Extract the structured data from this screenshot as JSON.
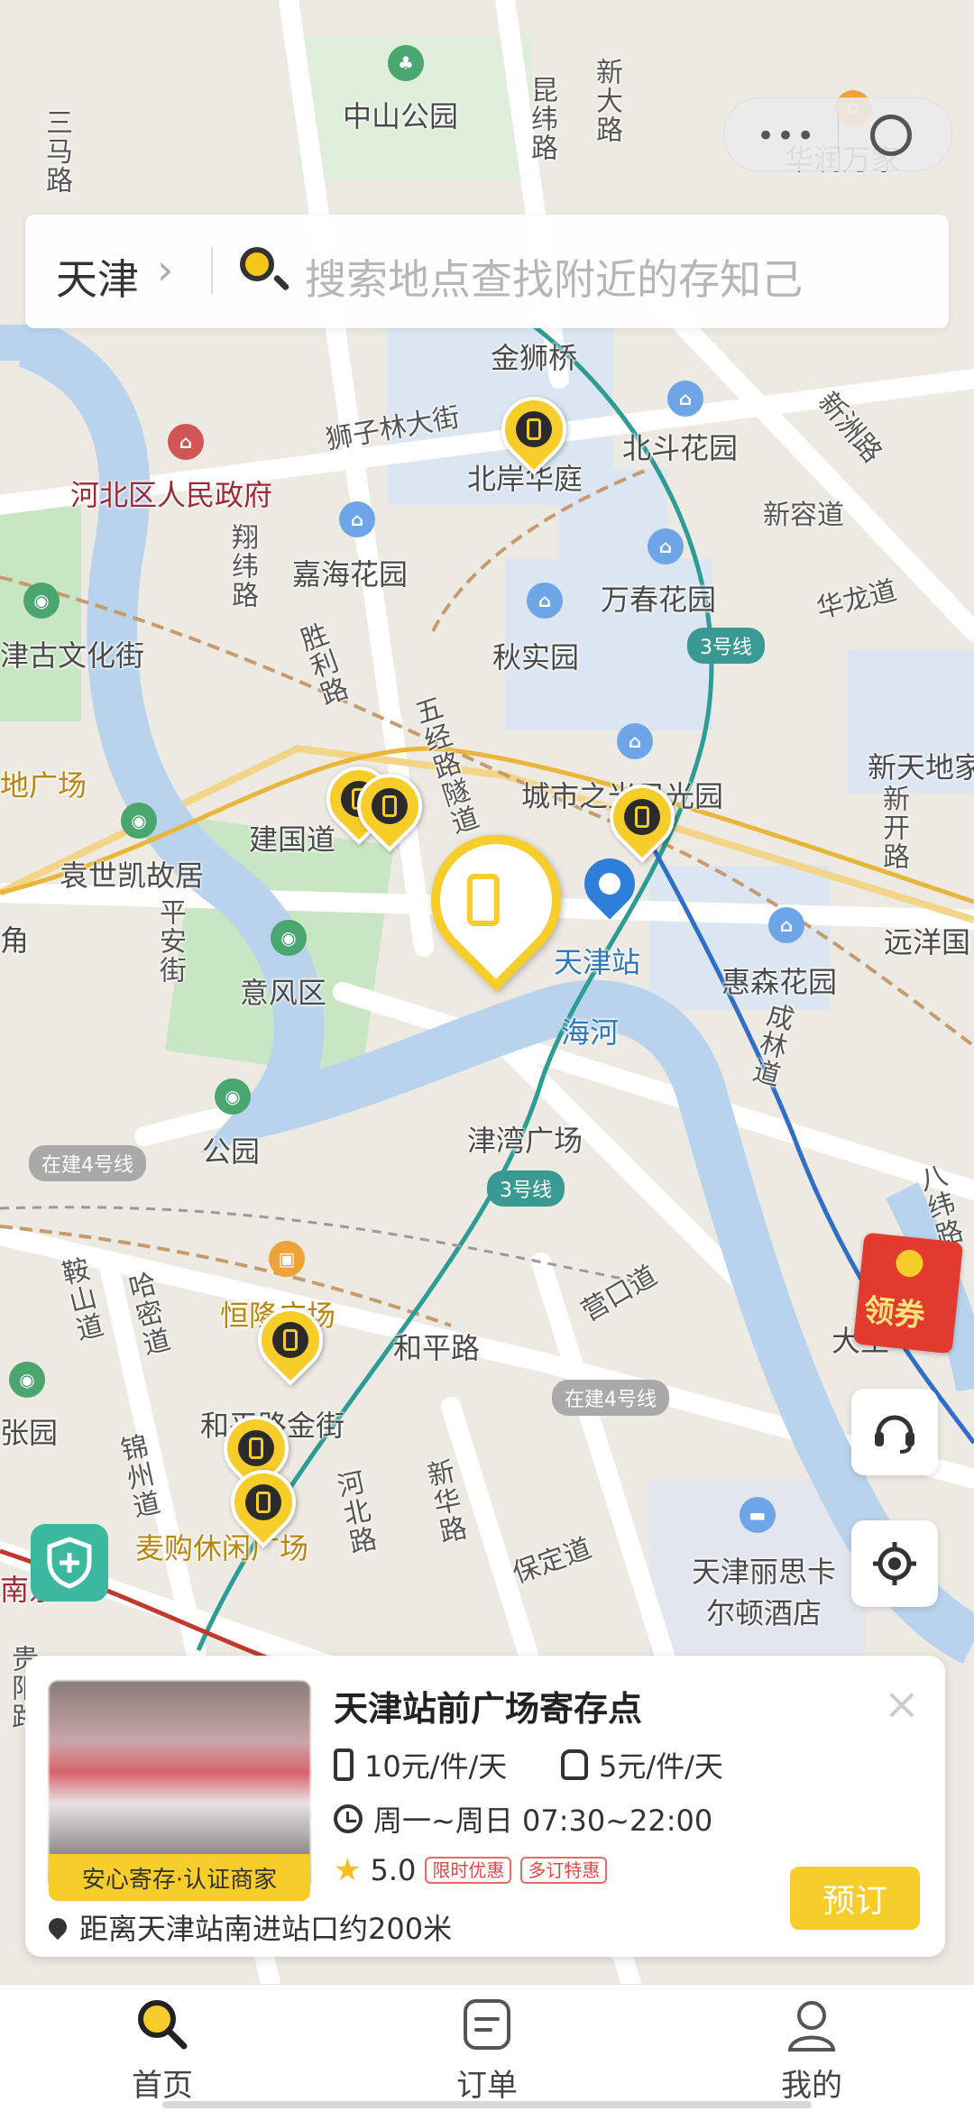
{
  "status_bar": {
    "time": "",
    "indicators": ""
  },
  "capsule": {
    "dots_label": "•••"
  },
  "search": {
    "city": "天津",
    "chevron": "›",
    "placeholder": "搜索地点查找附近的存知己"
  },
  "map": {
    "labels": {
      "zhongshan_park": "中山公园",
      "kunwei_rd": "昆纬路",
      "xinda_rd": "新大路",
      "sanma_rd": "三马路",
      "huarun": "华润万家",
      "jinshi_bridge": "金狮桥",
      "shizilin_st": "狮子林大街",
      "beian_huating": "北岸华庭",
      "beidou_garden": "北斗花园",
      "xinzhou_rd": "新洲路",
      "xinrong_dao": "新容道",
      "hebei_gov": "河北区人民政府",
      "xiangwei_rd": "翔纬路",
      "jiahai_garden": "嘉海花园",
      "wanchun_garden": "万春花园",
      "hualong_dao": "华龙道",
      "shishi_yuan": "秋实园",
      "line3_top": "3号线",
      "culture_st": "津古文化街",
      "shengli_rd": "胜利路",
      "jingsi_tunnel": "五经路隧道",
      "xintiandi": "新天地家",
      "xinkai_rd": "新开路",
      "chengshi": "城市之光日光园",
      "square_left": "地广场",
      "jianguo_dao": "建国道",
      "yuanshikai": "袁世凯故居",
      "jiao": "角",
      "ping_an_st": "平安街",
      "tianjin_station": "天津站",
      "huisen_garden": "惠森花园",
      "yuanyang": "远洋国",
      "yifeng": "意风区",
      "hai_river": "海河",
      "chenglin_rd": "成林道",
      "jinwan_square": "津湾广场",
      "gongyuan": "公园",
      "line4_left": "在建4号线",
      "line3_mid": "3号线",
      "bajing_rd": "八纬路",
      "hengyu_square": "恒隆广场",
      "anshan_dao": "鞍山道",
      "harbin_dao": "哈密道",
      "heping_rd": "和平路",
      "yingkou_dao": "营口道",
      "dawang": "大王",
      "zhangyuan": "张园",
      "heping_jinjie": "和平路金街",
      "line4_right": "在建4号线",
      "jinzhou_dao": "锦州道",
      "maigou": "麦购休闲广场",
      "hebei_rd": "河北路",
      "xinhua_rd": "新华路",
      "baoding_dao": "保定道",
      "ritz": "天津丽思卡尔顿酒店",
      "south": "南京",
      "guiyang_rd": "贵阳路"
    }
  },
  "coupon": {
    "label": "领券"
  },
  "card": {
    "title": "天津站前广场寄存点",
    "price_luggage": "10元/件/天",
    "price_bag": "5元/件/天",
    "hours": "周一~周日 07:30~22:00",
    "rating": "5.0",
    "tags": [
      "限时优惠",
      "多订特惠"
    ],
    "badge": "安心寄存·认证商家",
    "distance": "距离天津站南进站口约200米",
    "book_label": "预订",
    "close_label": "×"
  },
  "tabbar": {
    "items": [
      {
        "label": "首页",
        "icon": "search-icon"
      },
      {
        "label": "订单",
        "icon": "order-icon"
      },
      {
        "label": "我的",
        "icon": "profile-icon"
      }
    ]
  },
  "colors": {
    "brand_yellow": "#F6CD2A",
    "river": "#B9D3EC",
    "metro_teal": "#2C9C94",
    "metro_blue": "#2F6FC8"
  }
}
